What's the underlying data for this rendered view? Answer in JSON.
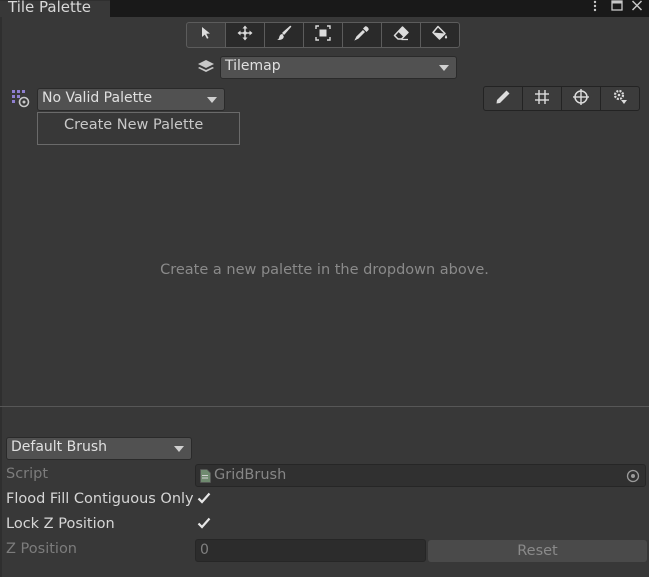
{
  "window": {
    "tab_title": "Tile Palette",
    "menu_icon": "kebab-menu-icon",
    "maximize_icon": "maximize-icon",
    "close_icon": "close-icon"
  },
  "tools": [
    {
      "name": "select-tool",
      "icon": "arrow-pointer-icon"
    },
    {
      "name": "move-tool",
      "icon": "move-arrows-icon"
    },
    {
      "name": "paint-tool",
      "icon": "paintbrush-icon"
    },
    {
      "name": "box-fill-tool",
      "icon": "box-select-icon"
    },
    {
      "name": "picker-tool",
      "icon": "eyedropper-icon"
    },
    {
      "name": "erase-tool",
      "icon": "eraser-icon"
    },
    {
      "name": "fill-tool",
      "icon": "paint-bucket-icon"
    }
  ],
  "tilemap": {
    "selected": "Tilemap",
    "icon": "layers-icon"
  },
  "palette": {
    "selected": "No Valid Palette",
    "icon": "palette-grid-icon",
    "menu_item": "Create New Palette"
  },
  "grid_tools": [
    {
      "name": "edit-palette-button",
      "icon": "pencil-icon"
    },
    {
      "name": "toggle-grid-button",
      "icon": "grid-icon"
    },
    {
      "name": "gizmo-button",
      "icon": "crosshair-icon"
    },
    {
      "name": "palette-settings-button",
      "icon": "gear-icon"
    }
  ],
  "hint_text": "Create a new palette in the dropdown above.",
  "brush": {
    "selected": "Default Brush",
    "script_label": "Script",
    "script_value": "GridBrush",
    "flood_fill_label": "Flood Fill Contiguous Only",
    "flood_fill_checked": true,
    "lock_z_label": "Lock Z Position",
    "lock_z_checked": true,
    "z_position_label": "Z Position",
    "z_position_value": "0",
    "reset_label": "Reset"
  },
  "colors": {
    "background": "#383838",
    "tab_strip": "#191919",
    "dropdown": "#515151"
  }
}
